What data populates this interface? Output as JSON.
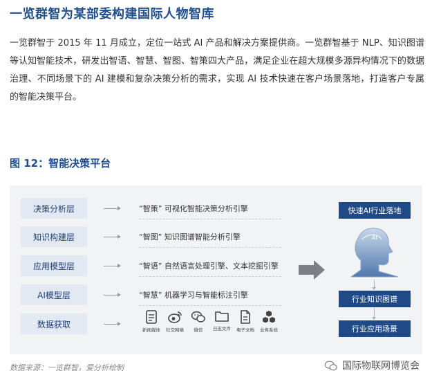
{
  "article": {
    "heading": "一览群智为某部委构建国际人物智库",
    "paragraph": "一览群智于 2015 年 11 月成立，定位一站式 AI 产品和解决方案提供商。一览群智基于 NLP、知识图谱等认知智能技术，研发出智语、智慧、智图、智策四大产品，满足企业在超大规模多源异构情况下的数据治理、不同场景下的 AI 建模和复杂决策分析的需求，实现 AI 技术快速在客户场景落地，打造客户专属的智能决策平台。"
  },
  "figure": {
    "title": "图 12：智能决策平台",
    "layers": [
      "决策分析层",
      "知识构建层",
      "应用模型层",
      "AI模型层",
      "数据获取"
    ],
    "engines": [
      "“智策” 可视化智能决策分析引擎",
      "“智图” 知识图谱智能分析引擎",
      "“智语” 自然语言处理引擎、文本挖掘引擎",
      "“智慧” 机器学习与智能标注引擎"
    ],
    "data_sources": [
      {
        "label": "新闻媒体",
        "icon": "news-document-icon"
      },
      {
        "label": "社交网络",
        "icon": "weibo-icon"
      },
      {
        "label": "微信",
        "icon": "wechat-icon"
      },
      {
        "label": "日志文件",
        "icon": "folder-icon"
      },
      {
        "label": "电子文档",
        "icon": "file-icon"
      },
      {
        "label": "业务系统",
        "icon": "cubes-icon"
      }
    ],
    "outputs": [
      "快速AI行业落地",
      "行业知识图谱",
      "行业应用场景"
    ],
    "head_label": "AI"
  },
  "source": "数据来源：一览群智，爱分析绘制",
  "watermark": "国际物联网博览会",
  "colors": {
    "accent": "#1e4e8c",
    "dark_button": "#1f4a86",
    "layer_button": "#e3e9f3",
    "panel": "#f2f3f5"
  }
}
